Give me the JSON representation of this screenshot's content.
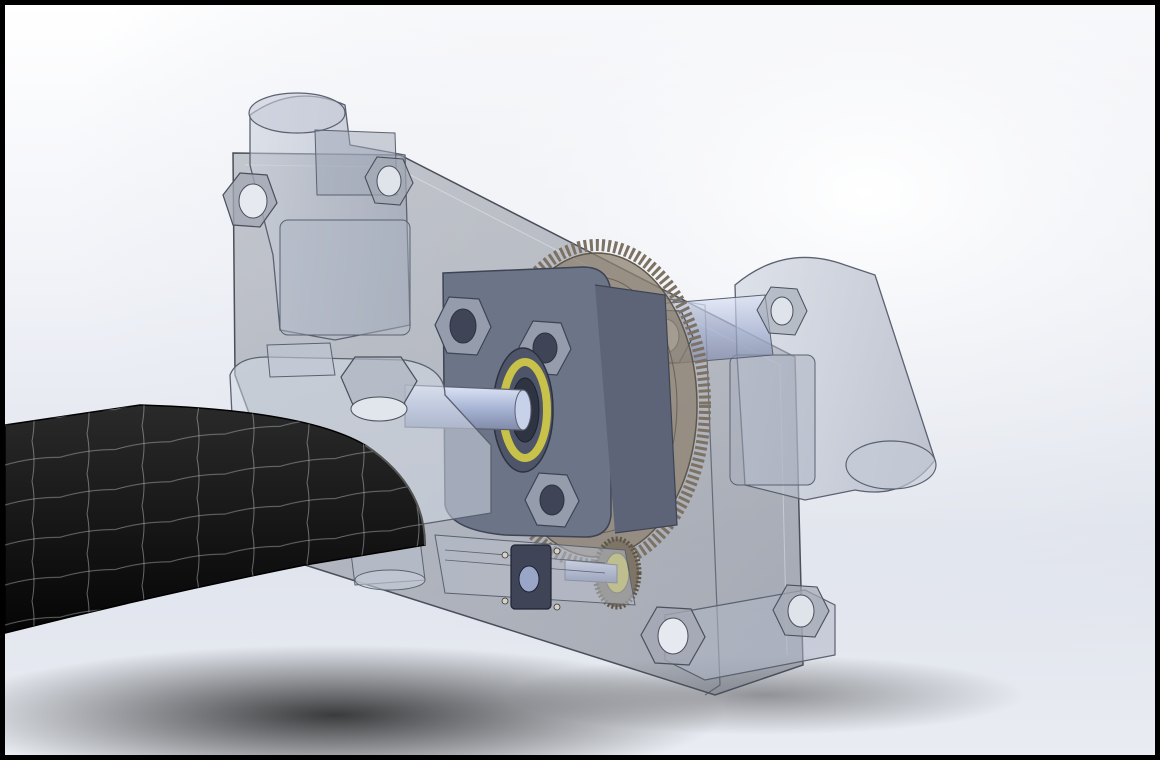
{
  "viewport": {
    "view_type": "cad-isometric-render",
    "display_style": "transparent-shaded",
    "frame_color": "#000000"
  },
  "colors": {
    "background_top": "#ffffff",
    "background_bottom": "#dfe3ec",
    "plate": "#8a8f99",
    "plate_edge": "#4a4f5a",
    "bracket": "#b8bfce",
    "flange": "#6c7488",
    "gear": "#8d8170",
    "bearing_ring": "#c8c24a",
    "shaft": "#b3bfe0",
    "blade": "#111111",
    "blade_grid": "#cfd2d8",
    "nut": "#9aa0ac"
  },
  "components": [
    "mounting-plate",
    "top-left-pivot-bracket",
    "right-pivot-bracket",
    "bottom-right-standoff",
    "motor-flange",
    "spur-gear",
    "ball-bearing",
    "output-shaft",
    "shaft-clamp",
    "pinion-gear",
    "circuit-board",
    "push-button",
    "carbon-blade"
  ]
}
